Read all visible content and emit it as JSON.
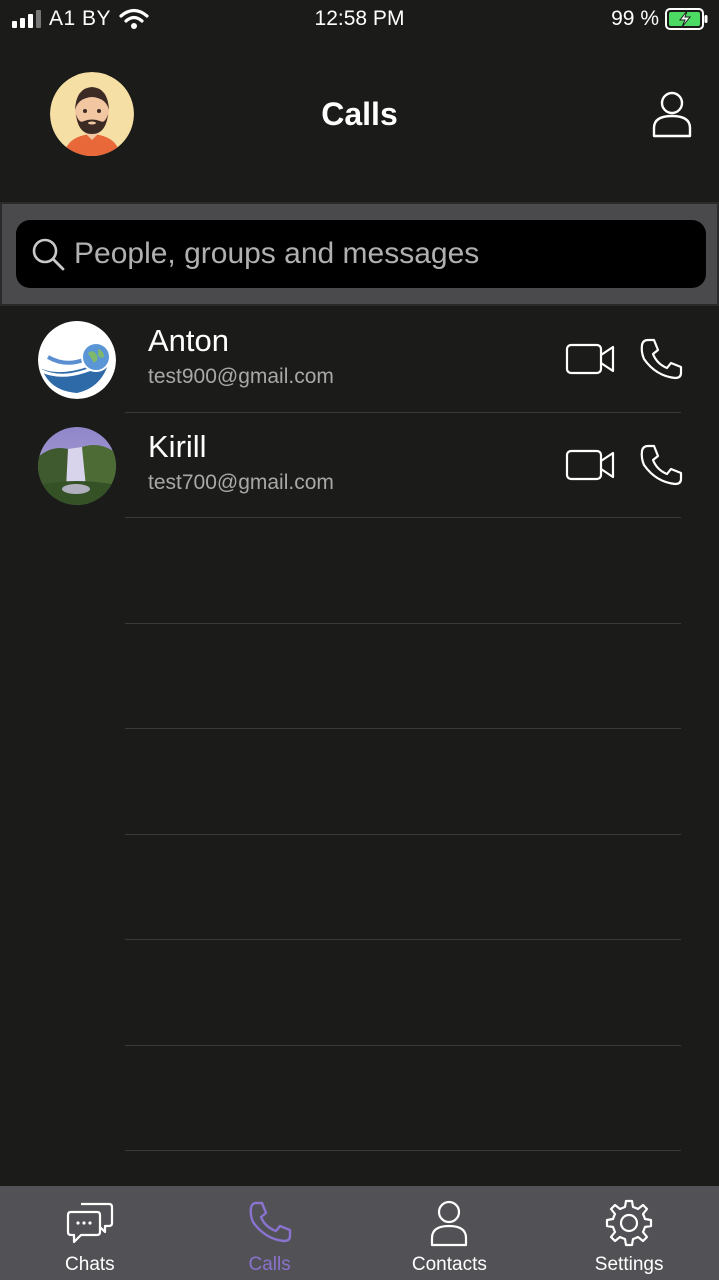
{
  "status_bar": {
    "carrier": "A1 BY",
    "time": "12:58 PM",
    "battery": "99 %",
    "icons": [
      "signal-icon",
      "wifi-icon",
      "battery-charging-icon"
    ]
  },
  "header": {
    "title": "Calls",
    "icons": [
      "avatar",
      "profile-icon"
    ]
  },
  "search": {
    "placeholder": "People, groups and messages",
    "icon": "search-icon"
  },
  "contacts": [
    {
      "name": "Anton",
      "email": "test900@gmail.com",
      "avatar": "globe-logo"
    },
    {
      "name": "Kirill",
      "email": "test700@gmail.com",
      "avatar": "waterfall-photo"
    }
  ],
  "tabs": [
    {
      "label": "Chats",
      "icon": "chat-bubbles-icon",
      "active": false
    },
    {
      "label": "Calls",
      "icon": "phone-icon",
      "active": true
    },
    {
      "label": "Contacts",
      "icon": "person-icon",
      "active": false
    },
    {
      "label": "Settings",
      "icon": "gear-icon",
      "active": false
    }
  ],
  "colors": {
    "background": "#1b1c19",
    "accent": "#8a72cf",
    "tab_bar": "#525256",
    "search_area": "#4a4a4c"
  }
}
